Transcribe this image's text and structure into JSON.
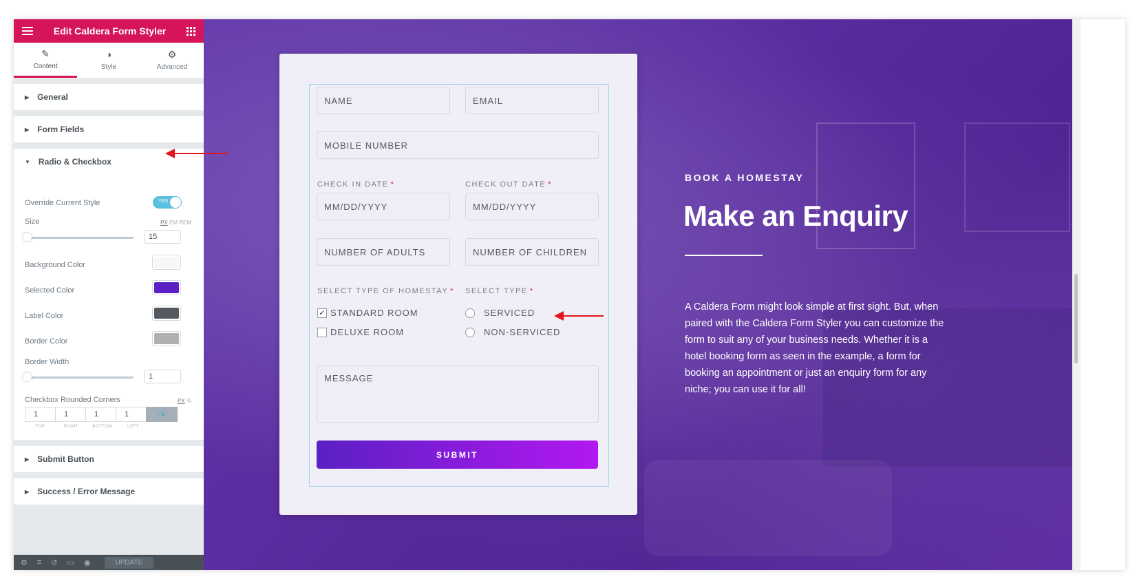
{
  "panel": {
    "title": "Edit Caldera Form Styler",
    "tabs": [
      {
        "label": "Content",
        "icon": "pencil-icon"
      },
      {
        "label": "Style",
        "icon": "contrast-icon"
      },
      {
        "label": "Advanced",
        "icon": "gear-icon"
      }
    ],
    "sections_top": [
      "General",
      "Form Fields",
      "Radio & Checkbox"
    ],
    "sections_bottom": [
      "Submit Button",
      "Success / Error Message"
    ],
    "controls": {
      "override_label": "Override Current Style",
      "override_toggle": "YES",
      "size_label": "Size",
      "size_units": [
        "PX",
        "EM",
        "REM"
      ],
      "size_value": "15",
      "bg_color_label": "Background Color",
      "selected_color_label": "Selected Color",
      "label_color_label": "Label Color",
      "border_color_label": "Border Color",
      "border_width_label": "Border Width",
      "border_width_value": "1",
      "corners_label": "Checkbox Rounded Corners",
      "corners_units": [
        "PX",
        "%"
      ],
      "corners_values": [
        "1",
        "1",
        "1",
        "1"
      ],
      "corners_labels": [
        "TOP",
        "RIGHT",
        "BOTTOM",
        "LEFT"
      ]
    },
    "colors": {
      "background": "#f7f7f9",
      "selected": "#5a20c4",
      "label": "#54595f",
      "border": "#b0b0b0"
    },
    "footer": {
      "update_label": "UPDATE"
    }
  },
  "form": {
    "name_placeholder": "NAME",
    "email_placeholder": "EMAIL",
    "mobile_placeholder": "MOBILE NUMBER",
    "checkin_label": "CHECK IN DATE",
    "checkout_label": "CHECK OUT DATE",
    "required_mark": "*",
    "date_placeholder": "MM/DD/YYYY",
    "adults_placeholder": "NUMBER OF ADULTS",
    "children_placeholder": "NUMBER OF CHILDREN",
    "homestay_label": "SELECT TYPE OF HOMESTAY",
    "type_label": "SELECT TYPE",
    "checkbox_options": [
      {
        "label": "STANDARD ROOM",
        "checked": true
      },
      {
        "label": "DELUXE ROOM",
        "checked": false
      }
    ],
    "radio_options": [
      "SERVICED",
      "NON-SERVICED"
    ],
    "message_placeholder": "MESSAGE",
    "submit_label": "SUBMIT"
  },
  "hero": {
    "eyebrow": "BOOK A HOMESTAY",
    "headline": "Make an Enquiry",
    "paragraph": "A Caldera Form might look simple at first sight. But, when paired with the Caldera Form Styler you can customize the form to suit any of your business needs. Whether it is a hotel booking form as seen in the example, a form for booking an appointment or just an enquiry form for any niche; you can use it for all!"
  }
}
